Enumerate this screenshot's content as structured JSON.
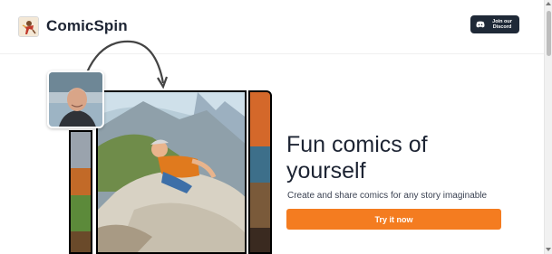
{
  "header": {
    "brand_name": "ComicSpin",
    "discord_button_label": "Join our Discord"
  },
  "hero": {
    "headline": "Fun comics of yourself",
    "subheadline": "Create and share comics for any story imaginable",
    "cta_label": "Try it now"
  },
  "colors": {
    "accent": "#f47c20",
    "discord_bg": "#1f2937",
    "text": "#1d2433"
  },
  "icons": {
    "logo": "comic-character-logo-icon",
    "discord": "discord-icon",
    "arrow": "curved-arrow-icon"
  }
}
